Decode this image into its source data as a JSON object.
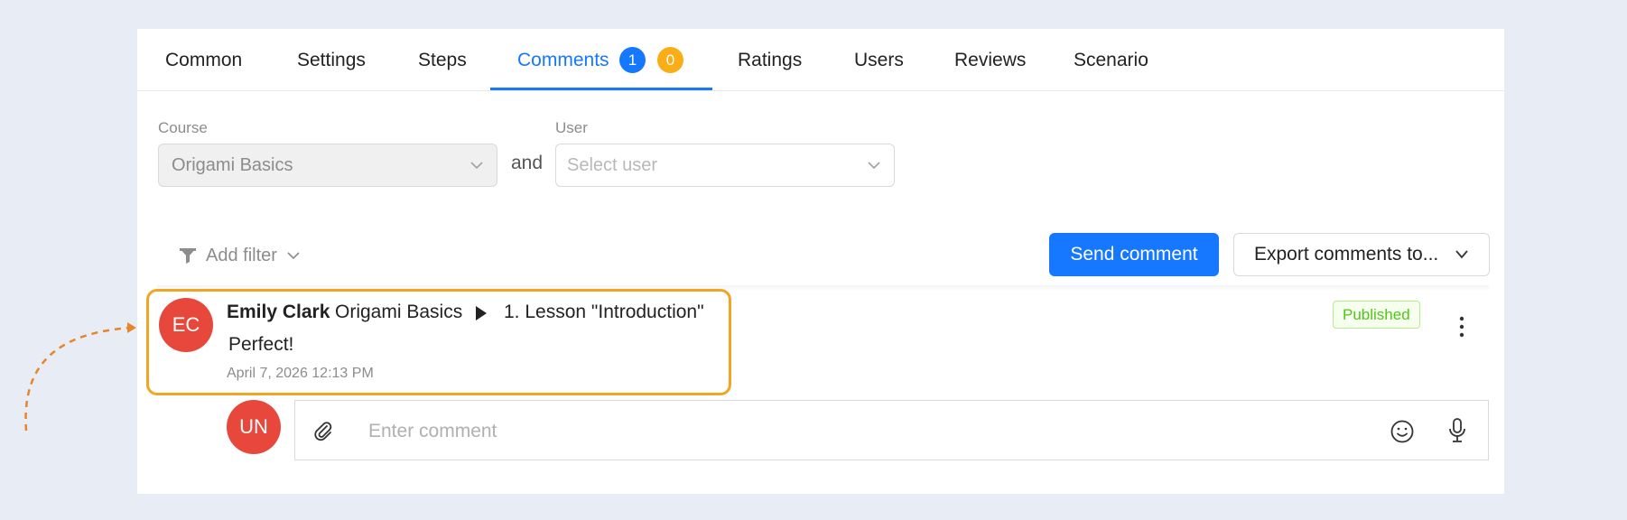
{
  "tabs": [
    {
      "label": "Common"
    },
    {
      "label": "Settings"
    },
    {
      "label": "Steps"
    },
    {
      "label": "Comments",
      "active": true,
      "badges": [
        "1",
        "0"
      ]
    },
    {
      "label": "Ratings"
    },
    {
      "label": "Users"
    },
    {
      "label": "Reviews"
    },
    {
      "label": "Scenario"
    }
  ],
  "filters": {
    "course_label": "Course",
    "course_value": "Origami Basics",
    "joiner": "and",
    "user_label": "User",
    "user_placeholder": "Select user",
    "add_filter": "Add filter"
  },
  "actions": {
    "send_comment": "Send comment",
    "export": "Export comments to..."
  },
  "comment": {
    "avatar_initials": "EC",
    "author": "Emily Clark",
    "course": "Origami Basics",
    "lesson": "1. Lesson \"Introduction\"",
    "text": "Perfect!",
    "date": "April 7, 2026 12:13 PM",
    "status": "Published"
  },
  "composer": {
    "avatar_initials": "UN",
    "placeholder": "Enter comment"
  },
  "colors": {
    "accent": "#1677ff",
    "badge_orange": "#faad14",
    "avatar_red": "#e8473b",
    "highlight": "#f0a623",
    "published_green": "#52c41a"
  }
}
